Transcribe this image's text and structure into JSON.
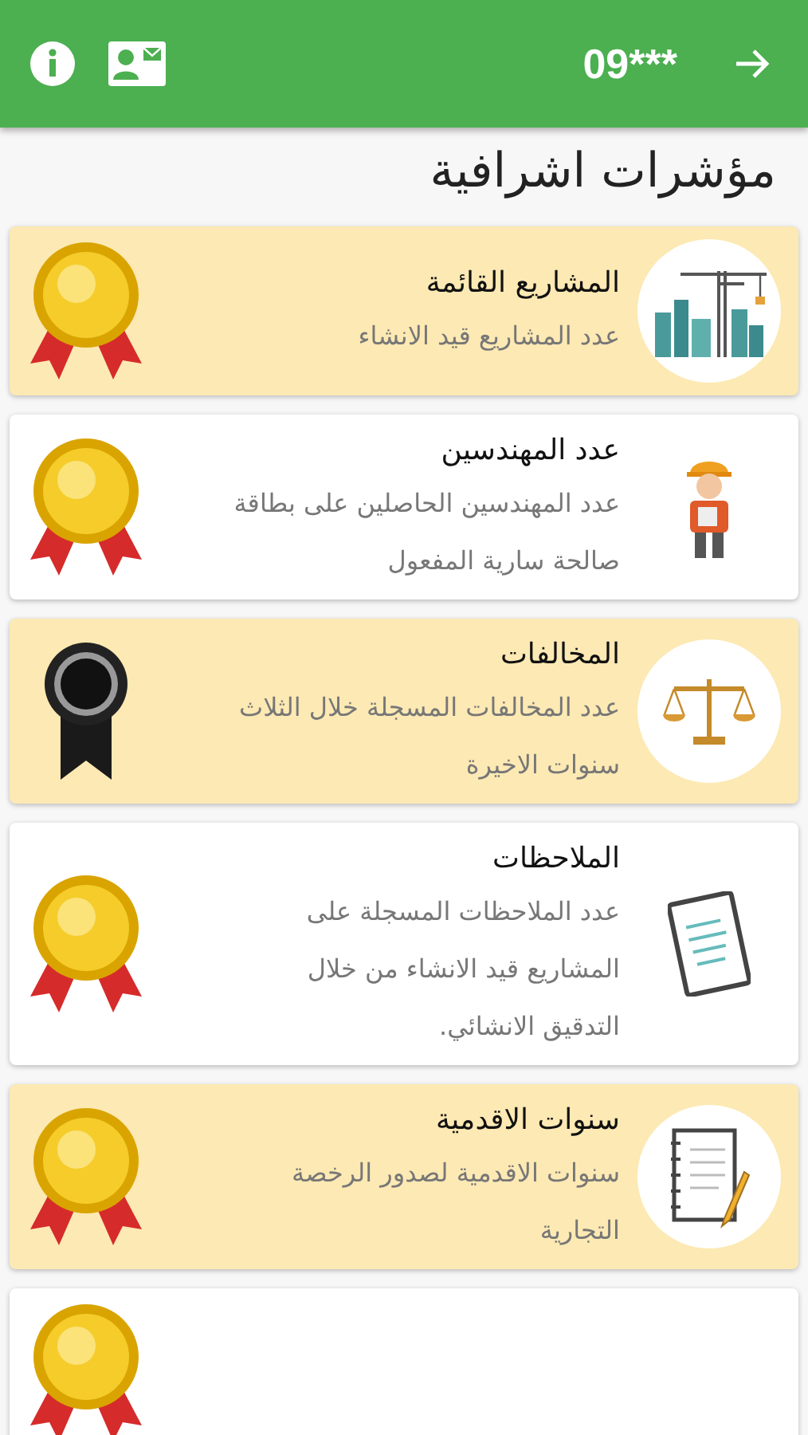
{
  "header": {
    "phone": "09***"
  },
  "title": "مؤشرات اشرافية",
  "cards": [
    {
      "title": "المشاريع القائمة",
      "description": "عدد المشاريع قيد الانشاء",
      "highlighted": true,
      "kind": "crane"
    },
    {
      "title": "عدد المهندسين",
      "description": "عدد المهندسين الحاصلين على بطاقة صالحة سارية المفعول",
      "highlighted": false,
      "kind": "engineer"
    },
    {
      "title": "المخالفات",
      "description": "عدد المخالفات المسجلة خلال الثلاث سنوات الاخيرة",
      "highlighted": true,
      "kind": "scales"
    },
    {
      "title": "الملاحظات",
      "description": "عدد الملاحظات المسجلة على المشاريع قيد الانشاء من خلال التدقيق الانشائي.",
      "highlighted": false,
      "kind": "checklist"
    },
    {
      "title": "سنوات الاقدمية",
      "description": "سنوات الاقدمية لصدور الرخصة التجارية",
      "highlighted": true,
      "kind": "notebook"
    },
    {
      "highlighted": false,
      "kind": "blank"
    }
  ]
}
